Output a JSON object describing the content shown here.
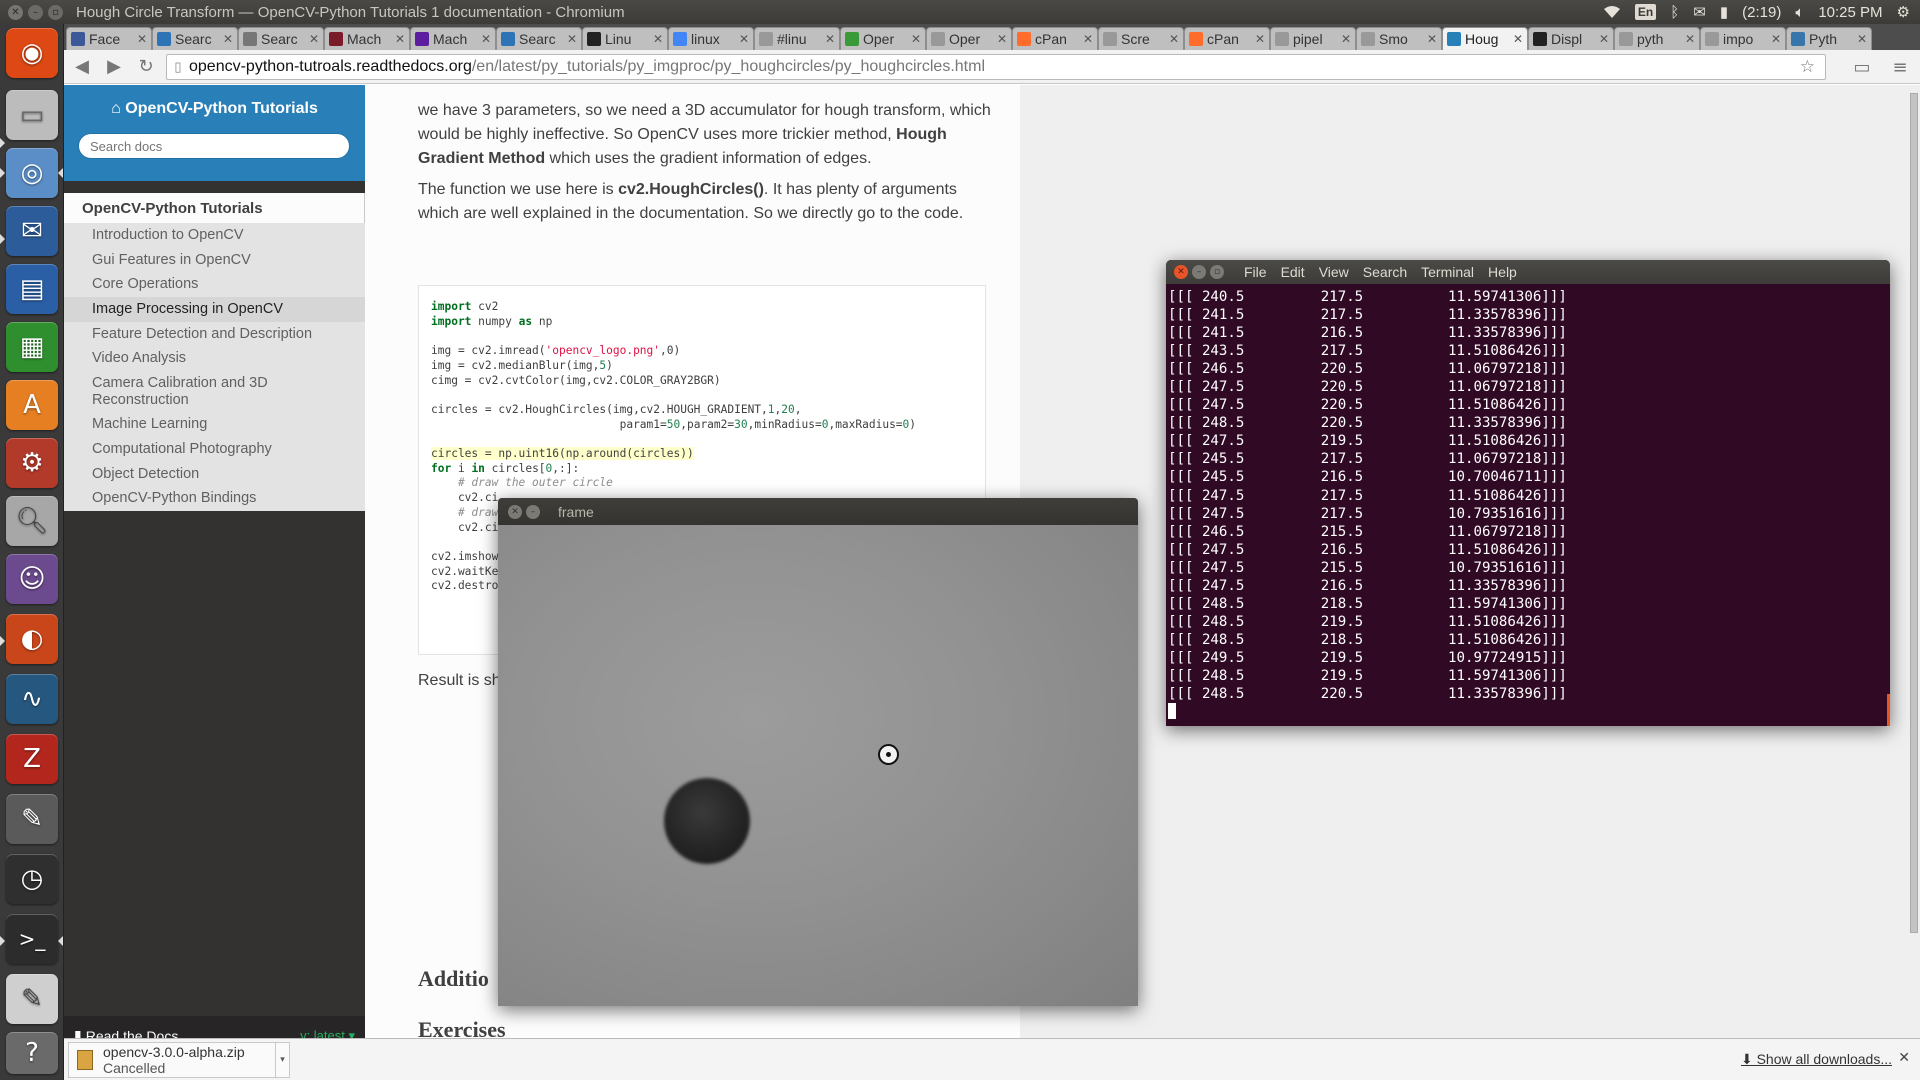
{
  "top_panel": {
    "title": "Hough Circle Transform — OpenCV-Python Tutorials 1 documentation - Chromium",
    "lang": "En",
    "battery": "(2:19)",
    "clock": "10:25 PM"
  },
  "launcher": {
    "apps": [
      "ubuntu-dash",
      "files",
      "chromium",
      "thunderbird",
      "libreoffice-writer",
      "libreoffice-calc",
      "software-center",
      "system-settings",
      "system-tool",
      "pidgin",
      "firefox",
      "system-monitor",
      "filezilla",
      "screenshot",
      "clock",
      "terminal",
      "text-editor",
      "help"
    ]
  },
  "browser": {
    "tabs": [
      {
        "label": "Face",
        "icon": "facebook-icon",
        "color": "#3b5998"
      },
      {
        "label": "Searc",
        "icon": "search-icon",
        "color": "#2d73b5"
      },
      {
        "label": "Searc",
        "icon": "gear-icon",
        "color": "#777777"
      },
      {
        "label": "Mach",
        "icon": "circle-icon",
        "color": "#7a1b2a"
      },
      {
        "label": "Mach",
        "icon": "yahoo-icon",
        "color": "#5c1e9e"
      },
      {
        "label": "Searc",
        "icon": "search-icon",
        "color": "#2d73b5"
      },
      {
        "label": "Linu",
        "icon": "x-icon",
        "color": "#222222"
      },
      {
        "label": "linux",
        "icon": "google-icon",
        "color": "#4285f4"
      },
      {
        "label": "#linu",
        "icon": "page-icon",
        "color": "#999999"
      },
      {
        "label": "Oper",
        "icon": "opencv-icon",
        "color": "#3a9a3a"
      },
      {
        "label": "Oper",
        "icon": "page-icon",
        "color": "#999999"
      },
      {
        "label": "cPan",
        "icon": "cpanel-icon",
        "color": "#ff6c2c"
      },
      {
        "label": "Scre",
        "icon": "page-icon",
        "color": "#999999"
      },
      {
        "label": "cPan",
        "icon": "cpanel-icon",
        "color": "#ff6c2c"
      },
      {
        "label": "pipel",
        "icon": "page-icon",
        "color": "#999999"
      },
      {
        "label": "Smo",
        "icon": "page-icon",
        "color": "#999999"
      },
      {
        "label": "Houg",
        "icon": "book-icon",
        "color": "#2980b9",
        "active": true
      },
      {
        "label": "Displ",
        "icon": "github-icon",
        "color": "#222222"
      },
      {
        "label": "pyth",
        "icon": "page-icon",
        "color": "#999999"
      },
      {
        "label": "impo",
        "icon": "page-icon",
        "color": "#999999"
      },
      {
        "label": "Pyth",
        "icon": "python-icon",
        "color": "#3776ab"
      }
    ],
    "url_host": "opencv-python-tutroals.readthedocs.org",
    "url_path": "/en/latest/py_tutorials/py_imgproc/py_houghcircles/py_houghcircles.html"
  },
  "sidebar": {
    "home_label": "⌂ OpenCV-Python Tutorials",
    "search_placeholder": "Search docs",
    "caption": "OpenCV-Python Tutorials",
    "items": [
      {
        "label": "Introduction to OpenCV"
      },
      {
        "label": "Gui Features in OpenCV"
      },
      {
        "label": "Core Operations"
      },
      {
        "label": "Image Processing in OpenCV",
        "current": true
      },
      {
        "label": "Feature Detection and Description"
      },
      {
        "label": "Video Analysis"
      },
      {
        "label": "Camera Calibration and 3D Reconstruction"
      },
      {
        "label": "Machine Learning"
      },
      {
        "label": "Computational Photography"
      },
      {
        "label": "Object Detection"
      },
      {
        "label": "OpenCV-Python Bindings"
      }
    ],
    "footer_label": "Read the Docs",
    "version_label": "v: latest ▾"
  },
  "doc": {
    "para1_a": "we have 3 parameters, so we need a 3D accumulator for hough transform, which would be highly ineffective. So OpenCV uses more trickier method, ",
    "para1_b": "Hough Gradient Method",
    "para1_c": " which uses the gradient information of edges.",
    "para2_a": "The function we use here is ",
    "para2_b": "cv2.HoughCircles()",
    "para2_c": ". It has plenty of arguments which are well explained in the documentation. So we directly go to the code.",
    "code": {
      "l1": "cv2",
      "l2": "numpy",
      "l2b": "np",
      "l4": "img = cv2.imread(",
      "l4s": "'opencv_logo.png'",
      "l4e": ",0)",
      "l5": "img = cv2.medianBlur(img,",
      "l5n": "5",
      "l5e": ")",
      "l6": "cimg = cv2.cvtColor(img,cv2.COLOR_GRAY2BGR)",
      "l8": "circles = cv2.HoughCircles(img,cv2.HOUGH_GRADIENT,",
      "l8n1": "1",
      "l8n2": "20",
      "l9a": "                            param1=",
      "l9n1": "50",
      "l9b": ",param2=",
      "l9n2": "30",
      "l9c": ",minRadius=",
      "l9n3": "0",
      "l9d": ",maxRadius=",
      "l9n4": "0",
      "l11": "circles = np.uint16(np.around(circles))",
      "l12": "for",
      "l12b": " i ",
      "l12c": "in",
      "l12d": " circles[",
      "l12n": "0",
      "l12e": ",:]:",
      "l13": "    # draw the outer circle",
      "l14": "    cv2.ci",
      "l15": "    # draw",
      "l16": "    cv2.ci",
      "l18": "cv2.imshow",
      "l19": "cv2.waitKe",
      "l20": "cv2.destro"
    },
    "result_text": "Result is sho",
    "heading_additional": "Additio",
    "heading_exercises": "Exercises"
  },
  "downloads": {
    "filename": "opencv-3.0.0-alpha.zip",
    "status": "Cancelled",
    "show_all": "Show all downloads..."
  },
  "terminal": {
    "menu": [
      "File",
      "Edit",
      "View",
      "Search",
      "Terminal",
      "Help"
    ],
    "rows": [
      [
        "240.5",
        "217.5",
        "11.59741306"
      ],
      [
        "241.5",
        "217.5",
        "11.33578396"
      ],
      [
        "241.5",
        "216.5",
        "11.33578396"
      ],
      [
        "243.5",
        "217.5",
        "11.51086426"
      ],
      [
        "246.5",
        "220.5",
        "11.06797218"
      ],
      [
        "247.5",
        "220.5",
        "11.06797218"
      ],
      [
        "247.5",
        "220.5",
        "11.51086426"
      ],
      [
        "248.5",
        "220.5",
        "11.33578396"
      ],
      [
        "247.5",
        "219.5",
        "11.51086426"
      ],
      [
        "245.5",
        "217.5",
        "11.06797218"
      ],
      [
        "245.5",
        "216.5",
        "10.70046711"
      ],
      [
        "247.5",
        "217.5",
        "11.51086426"
      ],
      [
        "247.5",
        "217.5",
        "10.79351616"
      ],
      [
        "246.5",
        "215.5",
        "11.06797218"
      ],
      [
        "247.5",
        "216.5",
        "11.51086426"
      ],
      [
        "247.5",
        "215.5",
        "10.79351616"
      ],
      [
        "247.5",
        "216.5",
        "11.33578396"
      ],
      [
        "248.5",
        "218.5",
        "11.59741306"
      ],
      [
        "248.5",
        "219.5",
        "11.51086426"
      ],
      [
        "248.5",
        "218.5",
        "11.51086426"
      ],
      [
        "249.5",
        "219.5",
        "10.97724915"
      ],
      [
        "248.5",
        "219.5",
        "11.59741306"
      ],
      [
        "248.5",
        "220.5",
        "11.33578396"
      ]
    ]
  },
  "frame_window": {
    "title": "frame"
  }
}
